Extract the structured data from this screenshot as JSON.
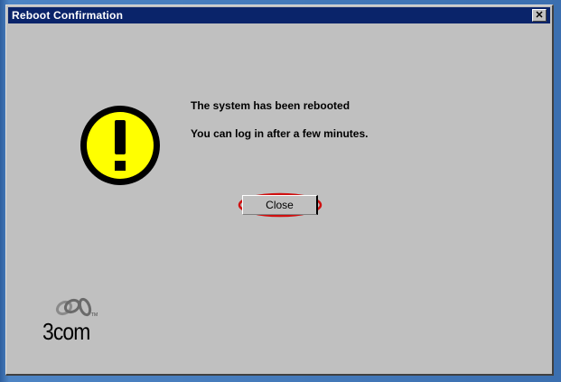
{
  "window": {
    "title": "Reboot Confirmation",
    "close_glyph": "✕"
  },
  "message": {
    "icon": "warning-icon",
    "line1": "The system has been rebooted",
    "line2": "You can log in after a few minutes."
  },
  "actions": {
    "close_label": "Close"
  },
  "branding": {
    "logo_text": "3com",
    "logo_icon": "3com-rings-logo"
  },
  "colors": {
    "titlebar": "#0a246a",
    "dialog_bg": "#c0c0c0",
    "warning_fill": "#ffff00",
    "highlight_ring": "#d01010"
  }
}
